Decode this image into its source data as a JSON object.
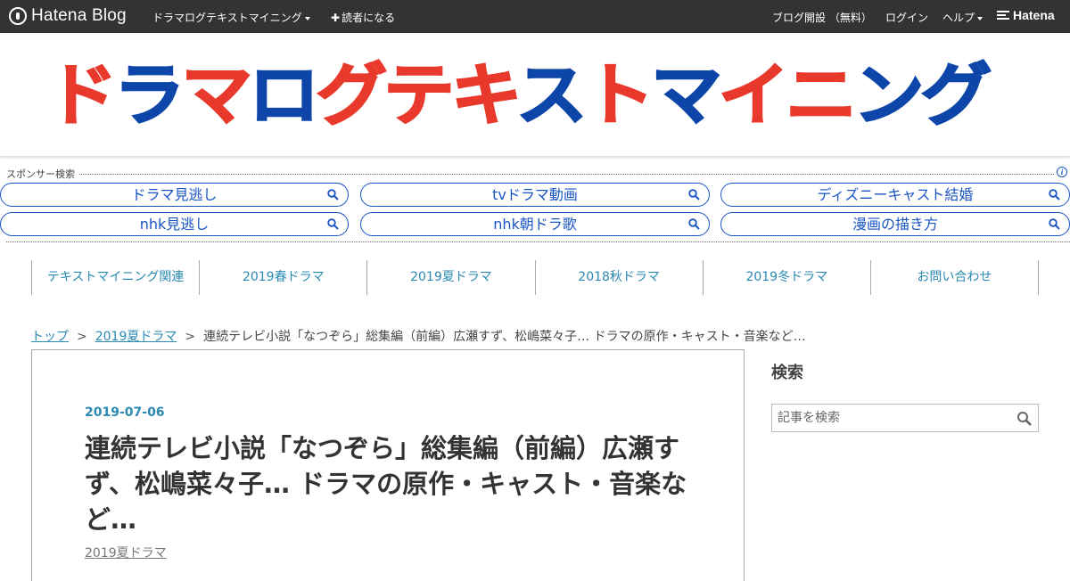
{
  "topbar": {
    "brand": "Hatena Blog",
    "blog_menu": "ドラマログテキストマイニング",
    "subscribe": "読者になる",
    "open_blog": "ブログ開設 （無料）",
    "login": "ログイン",
    "help": "ヘルプ",
    "hatena": "Hatena"
  },
  "header": {
    "title_parts": [
      "ド",
      "ラ",
      "マ",
      "ロ",
      "グ",
      "テ",
      "キ",
      "ス",
      "ト",
      "マ",
      "イ",
      "ニ",
      "ン",
      "グ"
    ]
  },
  "sponsor": {
    "label": "スポンサー検索",
    "info": "i",
    "items": [
      "ドラマ見逃し",
      "tvドラマ動画",
      "ディズニーキャスト結婚",
      "nhk見逃し",
      "nhk朝ドラ歌",
      "漫画の描き方"
    ]
  },
  "nav": [
    "テキストマイニング関連",
    "2019春ドラマ",
    "2019夏ドラマ",
    "2018秋ドラマ",
    "2019冬ドラマ",
    "お問い合わせ"
  ],
  "breadcrumb": {
    "top": "トップ",
    "sep": ">",
    "category": "2019夏ドラマ",
    "current": "連続テレビ小説「なつぞら」総集編（前編）広瀬すず、松嶋菜々子… ドラマの原作・キャスト・音楽など…"
  },
  "article": {
    "date": "2019-07-06",
    "title": "連続テレビ小説「なつぞら」総集編（前編）広瀬すず、松嶋菜々子… ドラマの原作・キャスト・音楽など…",
    "category": "2019夏ドラマ"
  },
  "sidebar": {
    "search_heading": "検索",
    "search_placeholder": "記事を検索"
  },
  "colors": {
    "topbar_bg": "#333333",
    "title_red": "#e8392c",
    "title_blue": "#0d46a8",
    "link_blue": "#2a8ab3",
    "sponsor_blue": "#1a55c4"
  }
}
